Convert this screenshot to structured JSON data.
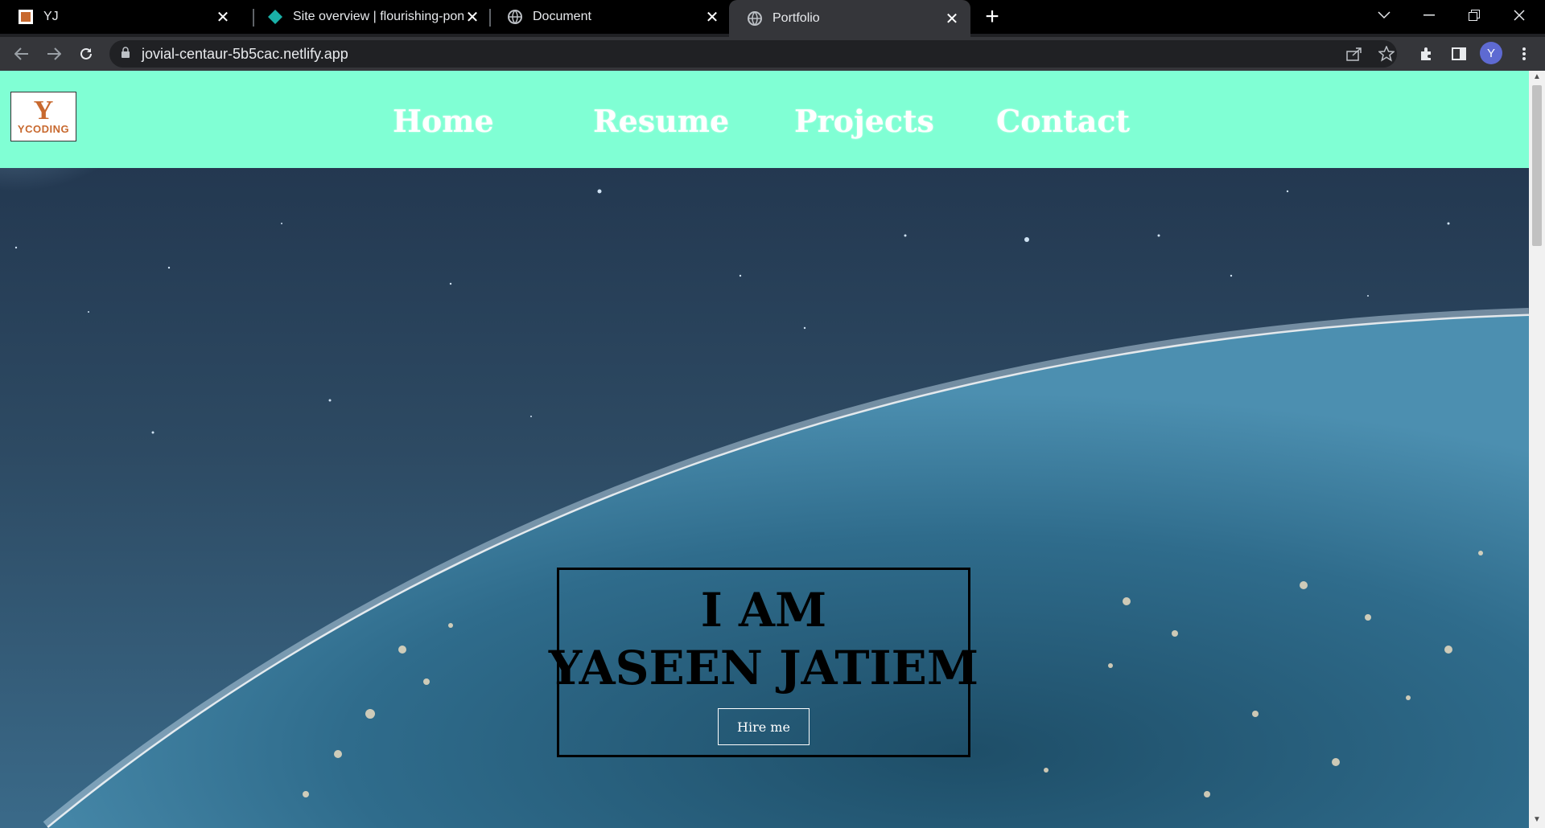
{
  "browser": {
    "tabs": [
      {
        "title": "YJ",
        "icon": "yj-favicon-icon",
        "active": false
      },
      {
        "title": "Site overview | flourishing-pony-",
        "icon": "netlify-icon",
        "active": false
      },
      {
        "title": "Document",
        "icon": "globe-icon",
        "active": false
      },
      {
        "title": "Portfolio",
        "icon": "globe-icon",
        "active": true
      }
    ],
    "url": "jovial-centaur-5b5cac.netlify.app",
    "profile_initial": "Y"
  },
  "page": {
    "logo": {
      "letter": "Y",
      "word": "YCODING"
    },
    "nav": {
      "home": "Home",
      "resume": "Resume",
      "projects": "Projects",
      "contact": "Contact"
    },
    "hero": {
      "line1": "I AM",
      "line2": "YASEEN JATIEM",
      "button": "Hire me"
    }
  },
  "colors": {
    "navbar_bg": "#80ffd4",
    "logo_accent": "#c8692f",
    "tabstrip_bg": "#000000",
    "toolbar_bg": "#35363a"
  }
}
